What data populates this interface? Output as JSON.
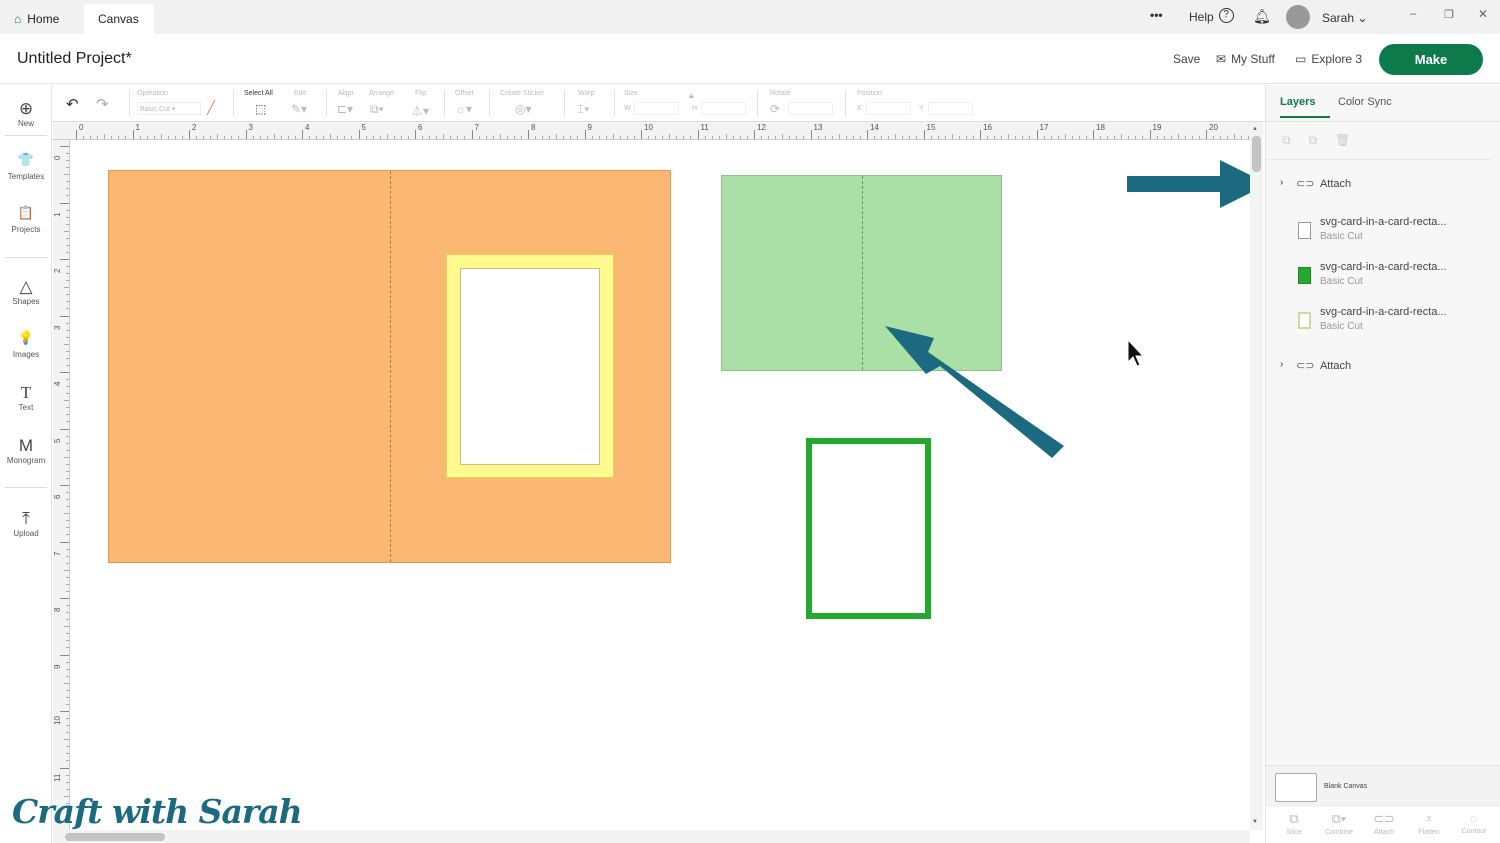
{
  "tabs": {
    "home": "Home",
    "canvas": "Canvas"
  },
  "topbar": {
    "more": "•••",
    "help": "Help",
    "user": "Sarah"
  },
  "header": {
    "title": "Untitled Project*",
    "save": "Save",
    "my_stuff": "My Stuff",
    "machine": "Explore 3",
    "make": "Make"
  },
  "sidebar": [
    {
      "label": "New",
      "icon": "⊕"
    },
    {
      "label": "Templates",
      "icon": "👕"
    },
    {
      "label": "Projects",
      "icon": "📋"
    },
    {
      "label": "Shapes",
      "icon": "△"
    },
    {
      "label": "Images",
      "icon": "💡"
    },
    {
      "label": "Text",
      "icon": "T"
    },
    {
      "label": "Monogram",
      "icon": "M"
    },
    {
      "label": "Upload",
      "icon": "⤒"
    }
  ],
  "toolbar": {
    "operation": "Operation",
    "operation_value": "Basic Cut",
    "select_all": "Select All",
    "edit": "Edit",
    "align": "Align",
    "arrange": "Arrange",
    "flip": "Flip",
    "offset": "Offset",
    "create_sticker": "Create Sticker",
    "warp": "Warp",
    "size": "Size",
    "w": "W",
    "h": "H",
    "rotate": "Rotate",
    "position": "Position",
    "x": "X",
    "y": "Y"
  },
  "ruler": {
    "top": [
      "0",
      "1",
      "2",
      "3",
      "4",
      "5",
      "6",
      "7",
      "8",
      "9",
      "10",
      "11",
      "12",
      "13",
      "14",
      "15",
      "16",
      "17",
      "18",
      "19",
      "20"
    ],
    "left": [
      "0",
      "1",
      "2",
      "3",
      "4",
      "5",
      "6",
      "7",
      "8",
      "9",
      "10",
      "11"
    ]
  },
  "colors": {
    "orange": "#fbb872",
    "yellow": "#fefa8e",
    "light_green": "#aadfa6",
    "green": "#25a82e",
    "arrow": "#1c6a80",
    "make": "#0c7a4a"
  },
  "panel": {
    "tab_layers": "Layers",
    "tab_color_sync": "Color Sync",
    "layers": [
      {
        "type": "group",
        "name": "Attach"
      },
      {
        "type": "item",
        "name": "svg-card-in-a-card-recta...",
        "op": "Basic Cut",
        "swatch": "#ffffff"
      },
      {
        "type": "item",
        "name": "svg-card-in-a-card-recta...",
        "op": "Basic Cut",
        "swatch": "#25a82e"
      },
      {
        "type": "item",
        "name": "svg-card-in-a-card-recta...",
        "op": "Basic Cut",
        "swatch": "#ffffff"
      },
      {
        "type": "group",
        "name": "Attach"
      }
    ],
    "blank_canvas": "Blank Canvas",
    "bottom": [
      "Slice",
      "Combine",
      "Attach",
      "Flatten",
      "Contour"
    ]
  },
  "watermark": "Craft with Sarah"
}
